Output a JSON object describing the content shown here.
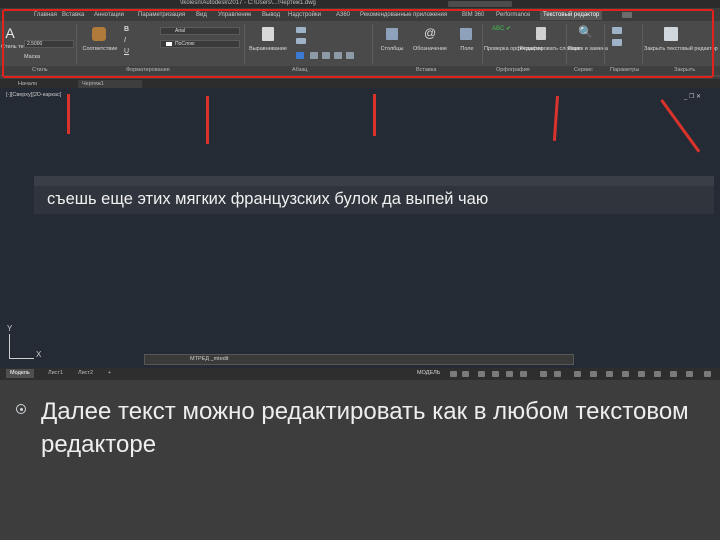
{
  "window": {
    "title": "\\Ikolesn\\Autodesk\\2017 - C:\\Users\\...\\Чертеж1.dwg",
    "search_placeholder": ""
  },
  "ribbon": {
    "tabs": [
      {
        "label": "Главная",
        "active": false
      },
      {
        "label": "Вставка",
        "active": false
      },
      {
        "label": "Аннотации",
        "active": false
      },
      {
        "label": "Параметризация",
        "active": false
      },
      {
        "label": "Вид",
        "active": false
      },
      {
        "label": "Управление",
        "active": false
      },
      {
        "label": "Вывод",
        "active": false
      },
      {
        "label": "Надстройки",
        "active": false
      },
      {
        "label": "A360",
        "active": false
      },
      {
        "label": "Рекомендованные приложения",
        "active": false
      },
      {
        "label": "BIM 360",
        "active": false
      },
      {
        "label": "Performance",
        "active": false
      },
      {
        "label": "Текстовый редактор",
        "active": true
      }
    ],
    "style_button": "Стиль текста",
    "text_height": "2.5000",
    "mask_label": "Маска",
    "font_value": "Arial",
    "layer_value": "ПоСлою",
    "match_label": "Соответствие",
    "justify_label": "Выравнивание",
    "columns_label": "Столбцы",
    "symbol_label": "Обозначение",
    "field_label": "Поле",
    "spell_label": "Проверка орфографии",
    "dict_label": "Редактировать словари",
    "find_label": "Поиск и замена",
    "close_label": "Закрыть текстовый редактор",
    "panels": [
      "Стиль",
      "Форматирование",
      "Абзац",
      "Вставка",
      "Орфография",
      "Сервис",
      "Параметры",
      "Закрыть"
    ]
  },
  "file_tabs": [
    "Начало",
    "Чертеж1"
  ],
  "drawing": {
    "viewport_label": "[-][Сверху][2D-каркас]",
    "viewport_controls": "_ ❐ ✕",
    "editor_text": "съешь еще этих мягких французских булок да выпей чаю",
    "ucs_x": "X",
    "ucs_y": "Y",
    "command_text": "МТРЕД _mtedit"
  },
  "layout_tabs": [
    "Модель",
    "Лист1",
    "Лист2",
    "+"
  ],
  "status": {
    "model_label": "МОДЕЛЬ"
  },
  "caption": "Далее текст можно редактировать как в любом текстовом редакторе",
  "colors": {
    "highlight": "#e2231a",
    "drawing_bg": "#252b35",
    "slide_bg": "#3d3d3d"
  }
}
